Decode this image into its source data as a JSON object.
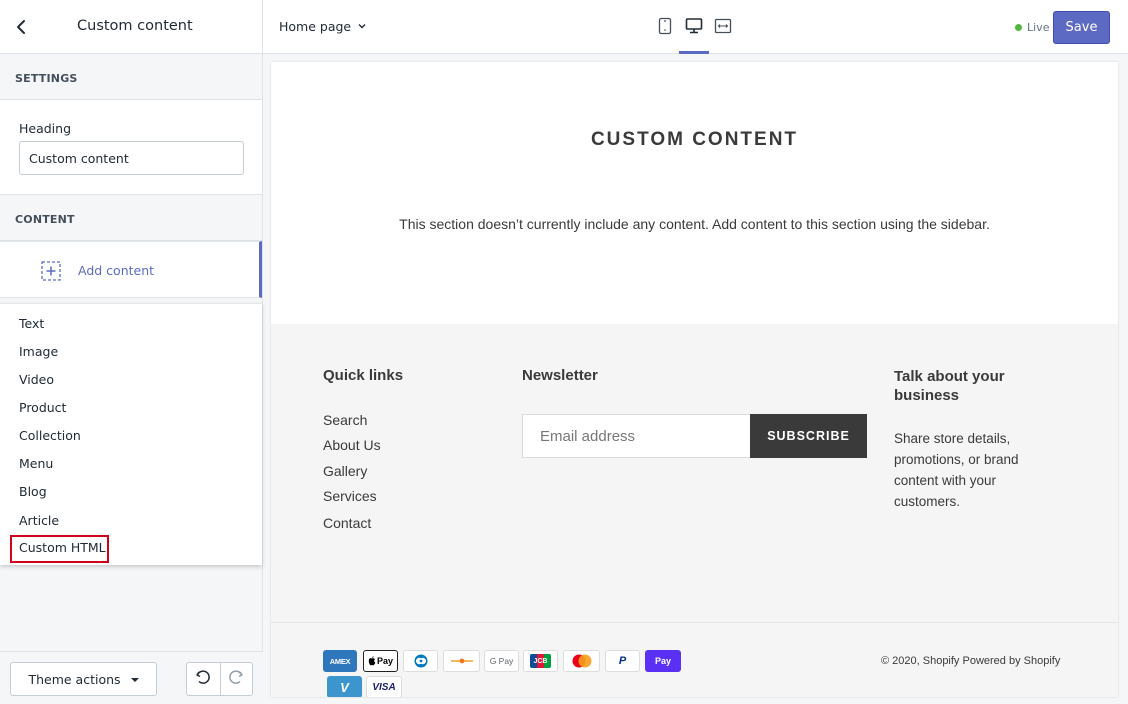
{
  "sidebar": {
    "title": "Custom content",
    "settings_label": "SETTINGS",
    "heading_label": "Heading",
    "heading_value": "Custom content",
    "content_label": "CONTENT",
    "add_content_label": "Add content",
    "block_types": [
      "Text",
      "Image",
      "Video",
      "Product",
      "Collection",
      "Menu",
      "Blog",
      "Article",
      "Custom HTML"
    ],
    "theme_actions_label": "Theme actions"
  },
  "topbar": {
    "page_select": "Home page",
    "live_label": "Live",
    "save_label": "Save"
  },
  "preview": {
    "title": "CUSTOM CONTENT",
    "empty_text": "This section doesn’t currently include any content. Add content to this section using the sidebar.",
    "footer": {
      "quick_links_heading": "Quick links",
      "links": [
        "Search",
        "About Us",
        "Gallery",
        "Services",
        "Contact"
      ],
      "newsletter_heading": "Newsletter",
      "email_placeholder": "Email address",
      "subscribe_label": "SUBSCRIBE",
      "about_heading": "Talk about your business",
      "about_text": "Share store details, promotions, or brand content with your customers.",
      "payments": [
        "AMEX",
        "Pay",
        "",
        "",
        "G Pay",
        "JCB",
        "",
        "P",
        "Pay",
        "V",
        "VISA"
      ],
      "copyright": "© 2020, Shopify",
      "powered_by": "Powered by Shopify"
    }
  },
  "colors": {
    "accent": "#5c6ac4",
    "highlight": "#d0021b",
    "live": "#50b83c"
  }
}
